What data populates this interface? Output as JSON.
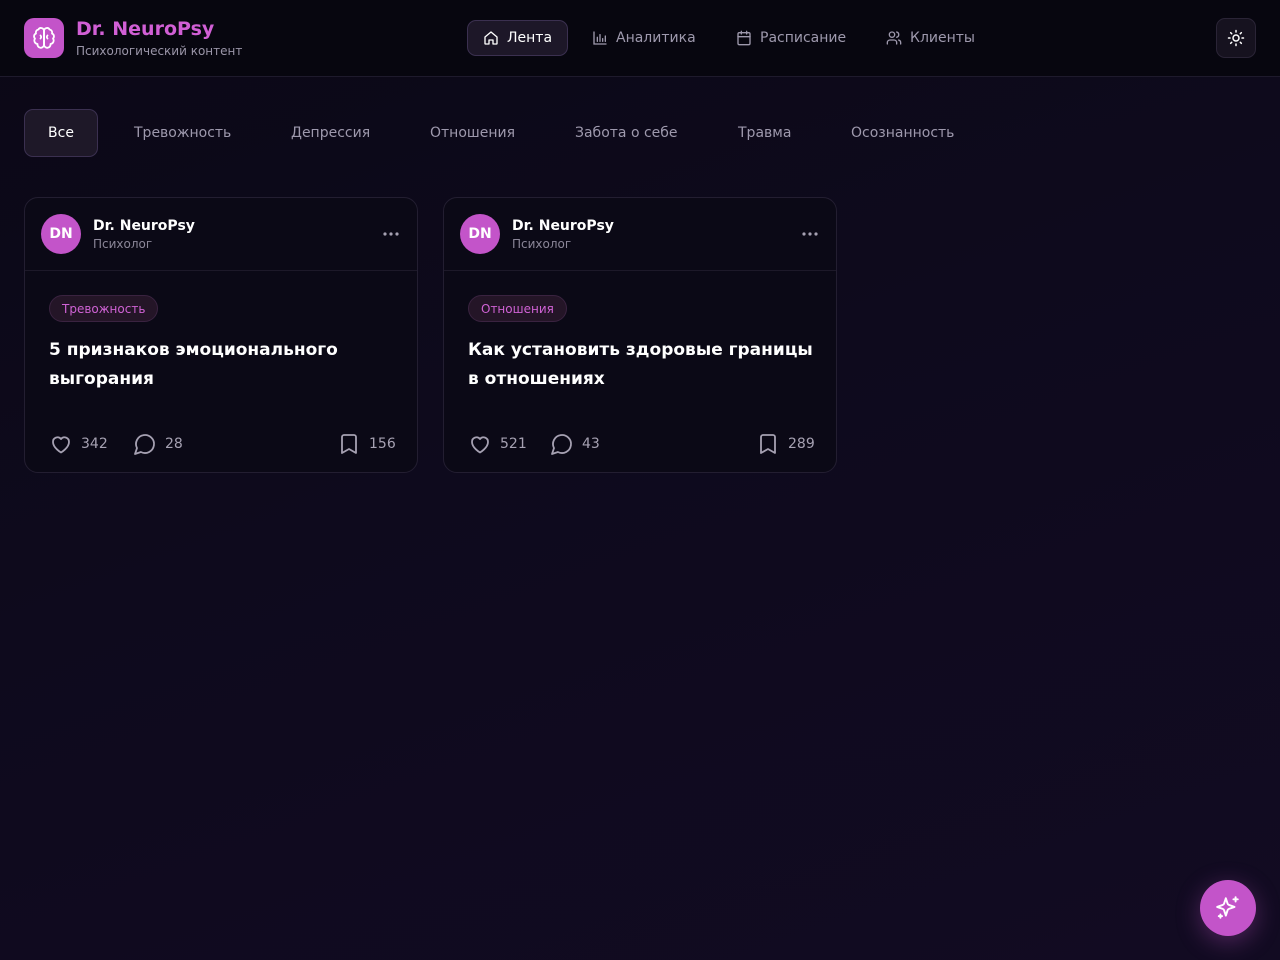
{
  "brand": {
    "title": "Dr. NeuroPsy",
    "subtitle": "Психологический контент",
    "icon": "brain-icon",
    "accent_color": "#c354c9"
  },
  "nav": {
    "items": [
      {
        "label": "Лента",
        "icon": "home-icon",
        "active": true
      },
      {
        "label": "Аналитика",
        "icon": "bar-chart-icon",
        "active": false
      },
      {
        "label": "Расписание",
        "icon": "calendar-icon",
        "active": false
      },
      {
        "label": "Клиенты",
        "icon": "users-icon",
        "active": false
      }
    ]
  },
  "theme_toggle": {
    "icon": "sun-icon"
  },
  "filters": {
    "selected": "Все",
    "items": [
      "Все",
      "Тревожность",
      "Депрессия",
      "Отношения",
      "Забота о себе",
      "Травма",
      "Осознанность"
    ]
  },
  "posts": [
    {
      "author": {
        "initials": "DN",
        "name": "Dr. NeuroPsy",
        "role": "Психолог"
      },
      "tag": "Тревожность",
      "title": "5 признаков эмоционального выгорания",
      "likes": "342",
      "comments": "28",
      "saves": "156"
    },
    {
      "author": {
        "initials": "DN",
        "name": "Dr. NeuroPsy",
        "role": "Психолог"
      },
      "tag": "Отношения",
      "title": "Как установить здоровые границы в отношениях",
      "likes": "521",
      "comments": "43",
      "saves": "289"
    }
  ],
  "fab": {
    "icon": "sparkles-icon"
  }
}
